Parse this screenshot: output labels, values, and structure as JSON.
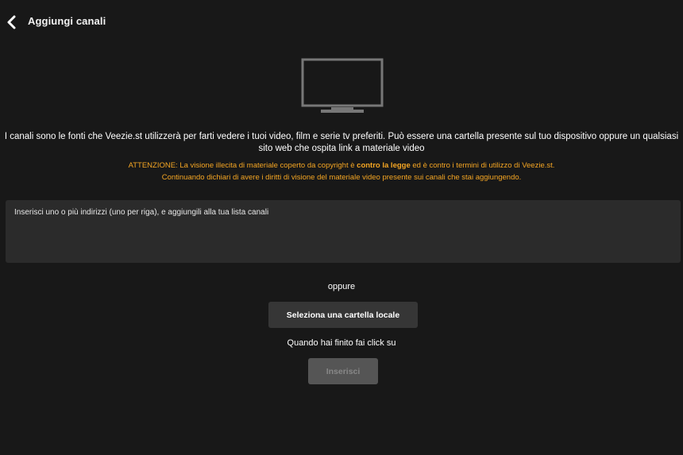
{
  "header": {
    "back_icon": "chevron-left-icon",
    "title": "Aggiungi canali"
  },
  "hero": {
    "icon": "tv-icon"
  },
  "intro": {
    "text": "I canali sono le fonti che Veezie.st utilizzerà per farti vedere i tuoi video, film e serie tv preferiti. Può essere una cartella presente sul tuo dispositivo oppure un qualsiasi sito web che ospita link a materiale video"
  },
  "warning": {
    "line1_prefix": "ATTENZIONE: La visione illecita di materiale coperto da copyright è ",
    "line1_bold": "contro la legge",
    "line1_suffix": " ed è contro i termini di utilizzo di Veezie.st.",
    "line2": "Continuando dichiari di avere i diritti di visione del materiale video presente sui canali che stai aggiungendo.",
    "color": "#f5a623"
  },
  "addresses": {
    "value": "",
    "placeholder": "Inserisci uno o più indirizzi (uno per riga), e aggiungili alla tua lista canali"
  },
  "alternative": {
    "label": "oppure",
    "folder_button": "Seleziona una cartella locale"
  },
  "finish": {
    "text": "Quando hai finito fai click su",
    "insert_button": "Inserisci",
    "insert_disabled": true
  },
  "colors": {
    "background": "#181818",
    "panel": "#2b2b2b",
    "accent": "#f5a623"
  }
}
